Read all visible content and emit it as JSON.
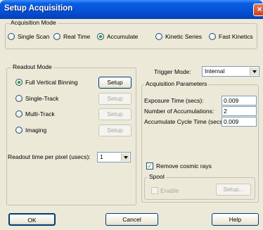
{
  "window": {
    "title": "Setup Acquisition",
    "close_glyph": "×"
  },
  "acquisition_mode": {
    "legend": "Acquisition Mode",
    "options": [
      {
        "label": "Single Scan",
        "selected": false
      },
      {
        "label": "Real Time",
        "selected": false
      },
      {
        "label": "Accumulate",
        "selected": true
      },
      {
        "label": "Kinetic Series",
        "selected": false
      },
      {
        "label": "Fast Kinetics",
        "selected": false
      }
    ]
  },
  "readout_mode": {
    "legend": "Readout Mode",
    "options": [
      {
        "label": "Full Vertical Binning",
        "selected": true,
        "setup_label": "Setup",
        "setup_enabled": true
      },
      {
        "label": "Single-Track",
        "selected": false,
        "setup_label": "Setup",
        "setup_enabled": false
      },
      {
        "label": "Multi-Track",
        "selected": false,
        "setup_label": "Setup",
        "setup_enabled": false
      },
      {
        "label": "Imaging",
        "selected": false,
        "setup_label": "Setup",
        "setup_enabled": false
      }
    ],
    "readout_time_label": "Readout time per pixel (usecs):",
    "readout_time_value": "1"
  },
  "trigger": {
    "label": "Trigger Mode:",
    "value": "Internal"
  },
  "acquisition_parameters": {
    "legend": "Acquisition Parameters",
    "fields": [
      {
        "label": "Exposure Time (secs):",
        "value": "0.009"
      },
      {
        "label": "Number of Accumulations:",
        "value": "2"
      },
      {
        "label": "Accumulate Cycle Time (secs):",
        "value": "0.009"
      }
    ]
  },
  "remove_cosmic_rays": {
    "label": "Remove cosmic rays",
    "checked": true,
    "check_glyph": "✓"
  },
  "spool": {
    "legend": "Spool",
    "enable_label": "Enable",
    "enabled": false,
    "setup_label": "Setup..."
  },
  "buttons": {
    "ok": "OK",
    "cancel": "Cancel",
    "help": "Help"
  }
}
